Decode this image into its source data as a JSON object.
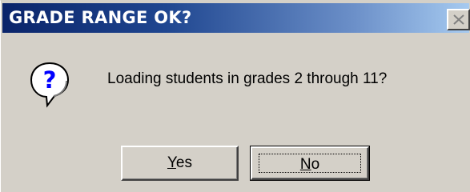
{
  "dialog": {
    "title": "GRADE RANGE OK?",
    "message": "Loading students in grades 2 through 11?",
    "icon": "question-icon"
  },
  "buttons": {
    "yes": {
      "mnemonic": "Y",
      "rest": "es"
    },
    "no": {
      "mnemonic": "N",
      "rest": "o"
    }
  },
  "titlebar": {
    "close_icon": "close-icon"
  },
  "colors": {
    "titlebar_start": "#0a246a",
    "titlebar_end": "#a6caf0",
    "face": "#d4d0c8",
    "icon_blue": "#0000ff"
  }
}
